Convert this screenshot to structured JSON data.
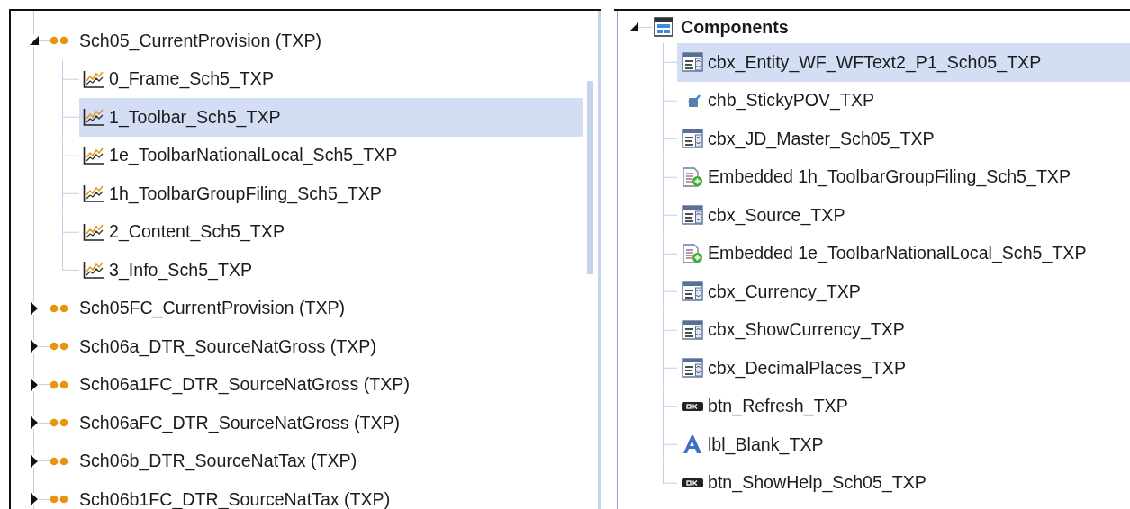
{
  "left_tree": {
    "items": [
      {
        "label": "Sch05_CurrentProvision (TXP)",
        "expanded": true,
        "selected": false,
        "children": [
          {
            "label": "0_Frame_Sch5_TXP",
            "selected": false
          },
          {
            "label": "1_Toolbar_Sch5_TXP",
            "selected": true
          },
          {
            "label": "1e_ToolbarNationalLocal_Sch5_TXP",
            "selected": false
          },
          {
            "label": "1h_ToolbarGroupFiling_Sch5_TXP",
            "selected": false
          },
          {
            "label": "2_Content_Sch5_TXP",
            "selected": false
          },
          {
            "label": "3_Info_Sch5_TXP",
            "selected": false
          }
        ]
      },
      {
        "label": "Sch05FC_CurrentProvision (TXP)",
        "expanded": false,
        "selected": false
      },
      {
        "label": "Sch06a_DTR_SourceNatGross (TXP)",
        "expanded": false,
        "selected": false
      },
      {
        "label": "Sch06a1FC_DTR_SourceNatGross (TXP)",
        "expanded": false,
        "selected": false
      },
      {
        "label": "Sch06aFC_DTR_SourceNatGross (TXP)",
        "expanded": false,
        "selected": false
      },
      {
        "label": "Sch06b_DTR_SourceNatTax (TXP)",
        "expanded": false,
        "selected": false
      },
      {
        "label": "Sch06b1FC_DTR_SourceNatTax (TXP)",
        "expanded": false,
        "selected": false
      }
    ]
  },
  "components": {
    "label": "Components",
    "expanded": true,
    "selected": false,
    "children": [
      {
        "label": "cbx_Entity_WF_WFText2_P1_Sch05_TXP",
        "kind": "combobox",
        "selected": true
      },
      {
        "label": "chb_StickyPOV_TXP",
        "kind": "checkbox",
        "selected": false
      },
      {
        "label": "cbx_JD_Master_Sch05_TXP",
        "kind": "combobox",
        "selected": false
      },
      {
        "label": "Embedded 1h_ToolbarGroupFiling_Sch5_TXP",
        "kind": "embedded",
        "selected": false
      },
      {
        "label": "cbx_Source_TXP",
        "kind": "combobox",
        "selected": false
      },
      {
        "label": "Embedded 1e_ToolbarNationalLocal_Sch5_TXP",
        "kind": "embedded",
        "selected": false
      },
      {
        "label": "cbx_Currency_TXP",
        "kind": "combobox",
        "selected": false
      },
      {
        "label": "cbx_ShowCurrency_TXP",
        "kind": "combobox",
        "selected": false
      },
      {
        "label": "cbx_DecimalPlaces_TXP",
        "kind": "combobox",
        "selected": false
      },
      {
        "label": "btn_Refresh_TXP",
        "kind": "button",
        "selected": false
      },
      {
        "label": "lbl_Blank_TXP",
        "kind": "label",
        "selected": false
      },
      {
        "label": "btn_ShowHelp_Sch05_TXP",
        "kind": "button",
        "selected": false
      }
    ]
  }
}
